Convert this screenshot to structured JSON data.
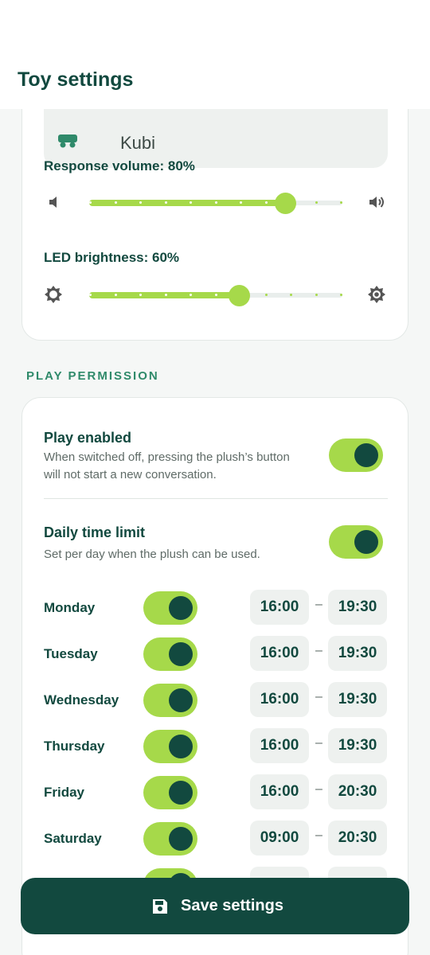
{
  "app_bar": {
    "title": "Toy settings"
  },
  "toy": {
    "name": "Kubi"
  },
  "volume": {
    "label": "Response volume: 80%",
    "value": 0.8,
    "steps": 10
  },
  "brightness": {
    "label": "LED brightness: 60%",
    "value": 0.6,
    "steps": 10
  },
  "section_play": {
    "title": "PLAY PERMISSION"
  },
  "play_enabled": {
    "title": "Play enabled",
    "description": "When switched off, pressing the plush’s button will not start a new conversation.",
    "on": true
  },
  "daily_limit": {
    "title": "Daily time limit",
    "description": "Set per day when the plush can be used.",
    "on": true
  },
  "schedule": [
    {
      "day": "Monday",
      "on": true,
      "start": "16:00",
      "end": "19:30"
    },
    {
      "day": "Tuesday",
      "on": true,
      "start": "16:00",
      "end": "19:30"
    },
    {
      "day": "Wednesday",
      "on": true,
      "start": "16:00",
      "end": "19:30"
    },
    {
      "day": "Thursday",
      "on": true,
      "start": "16:00",
      "end": "19:30"
    },
    {
      "day": "Friday",
      "on": true,
      "start": "16:00",
      "end": "20:30"
    },
    {
      "day": "Saturday",
      "on": true,
      "start": "09:00",
      "end": "20:30"
    }
  ],
  "time_separator": "–",
  "save_button": {
    "label": "Save settings",
    "icon": "save-icon"
  },
  "colors": {
    "primary": "#12493f",
    "accent": "#a6d94a",
    "section": "#2f8a6a"
  }
}
